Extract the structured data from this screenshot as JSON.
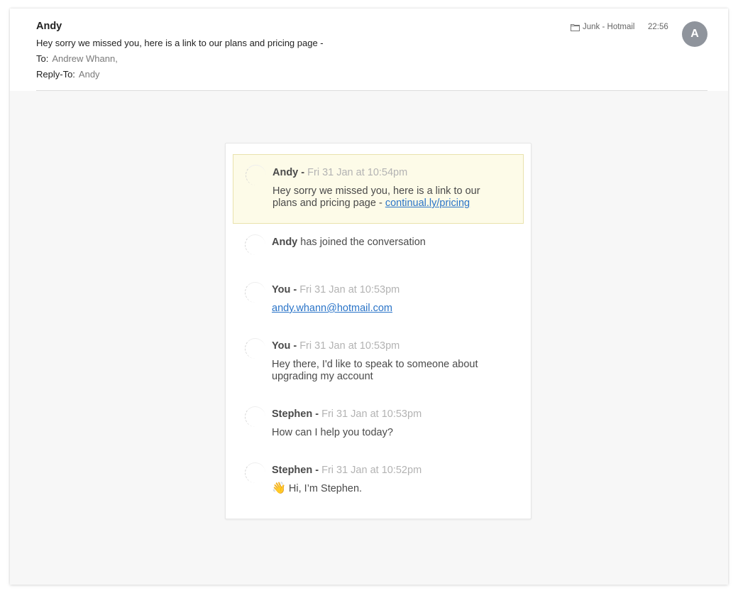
{
  "header": {
    "sender": "Andy",
    "subject": "Hey sorry we missed you, here is a link to our plans and pricing page -",
    "to_label": "To:",
    "to_value": "Andrew Whann,",
    "reply_to_label": "Reply-To:",
    "reply_to_value": "Andy",
    "folder": "Junk - Hotmail",
    "time": "22:56",
    "avatar_initial": "A"
  },
  "messages": [
    {
      "author": "Andy",
      "sep": " -",
      "date": "Fri 31 Jan at 10:54pm",
      "text": "Hey sorry we missed you, here is a link to our plans and pricing page -",
      "link": "continual.ly/pricing"
    },
    {
      "author": "Andy",
      "text": "has joined the conversation"
    },
    {
      "author": "You",
      "sep": " -",
      "date": "Fri 31 Jan at 10:53pm",
      "link": "andy.whann@hotmail.com"
    },
    {
      "author": "You",
      "sep": " -",
      "date": "Fri 31 Jan at 10:53pm",
      "text": "Hey there, I'd like to speak to someone about upgrading my account"
    },
    {
      "author": "Stephen",
      "sep": " -",
      "date": "Fri 31 Jan at 10:53pm",
      "text": "How can I help you today?"
    },
    {
      "author": "Stephen",
      "sep": " -",
      "date": "Fri 31 Jan at 10:52pm",
      "emoji": "👋",
      "text": "Hi, I’m Stephen."
    }
  ],
  "colors": {
    "highlight_bg": "#fdfbe8",
    "link": "#2a74c8",
    "avatar": "#8f949c"
  },
  "icons": {
    "folder": "folder-icon",
    "wave": "waving-hand-emoji"
  }
}
